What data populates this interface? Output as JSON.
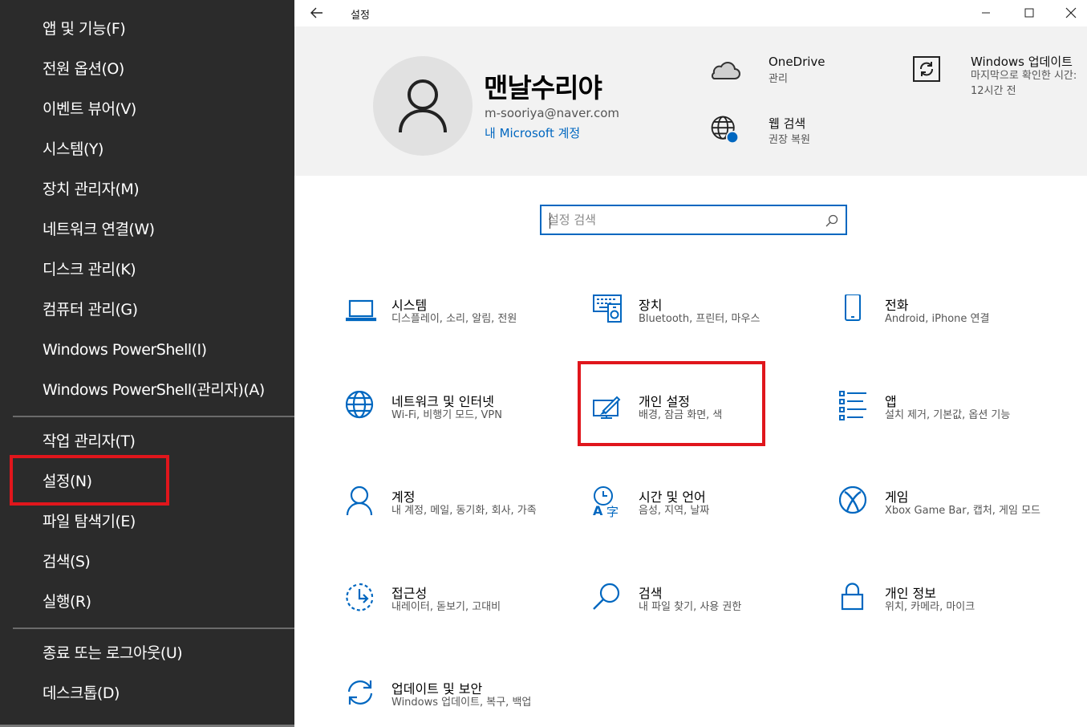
{
  "winx_menu": {
    "items": [
      {
        "label": "앱 및 기능(F)"
      },
      {
        "label": "전원 옵션(O)"
      },
      {
        "label": "이벤트 뷰어(V)"
      },
      {
        "label": "시스템(Y)"
      },
      {
        "label": "장치 관리자(M)"
      },
      {
        "label": "네트워크 연결(W)"
      },
      {
        "label": "디스크 관리(K)"
      },
      {
        "label": "컴퓨터 관리(G)"
      },
      {
        "label": "Windows PowerShell(I)"
      },
      {
        "label": "Windows PowerShell(관리자)(A)"
      },
      {
        "label": "작업 관리자(T)"
      },
      {
        "label": "설정(N)"
      },
      {
        "label": "파일 탐색기(E)"
      },
      {
        "label": "검색(S)"
      },
      {
        "label": "실행(R)"
      },
      {
        "label": "종료 또는 로그아웃(U)"
      },
      {
        "label": "데스크톱(D)"
      }
    ]
  },
  "window": {
    "title": "설정"
  },
  "account": {
    "name": "맨날수리야",
    "email": "m-sooriya@naver.com",
    "link": "내 Microsoft 계정"
  },
  "header_status": {
    "onedrive": {
      "title": "OneDrive",
      "sub": "관리"
    },
    "web_search": {
      "title": "웹 검색",
      "sub": "권장 복원"
    },
    "windows_update": {
      "title": "Windows 업데이트",
      "sub": "마지막으로 확인한 시간: 12시간 전"
    }
  },
  "search": {
    "placeholder": "설정 검색"
  },
  "categories": [
    {
      "title": "시스템",
      "sub": "디스플레이, 소리, 알림, 전원",
      "icon": "laptop-icon"
    },
    {
      "title": "장치",
      "sub": "Bluetooth, 프린터, 마우스",
      "icon": "devices-icon"
    },
    {
      "title": "전화",
      "sub": "Android, iPhone 연결",
      "icon": "phone-icon"
    },
    {
      "title": "네트워크 및 인터넷",
      "sub": "Wi-Fi, 비행기 모드, VPN",
      "icon": "globe-icon"
    },
    {
      "title": "개인 설정",
      "sub": "배경, 잠금 화면, 색",
      "icon": "personalization-icon"
    },
    {
      "title": "앱",
      "sub": "설치 제거, 기본값, 옵션 기능",
      "icon": "apps-list-icon"
    },
    {
      "title": "계정",
      "sub": "내 계정, 메일, 동기화, 회사, 가족",
      "icon": "person-icon"
    },
    {
      "title": "시간 및 언어",
      "sub": "음성, 지역, 날짜",
      "icon": "time-language-icon"
    },
    {
      "title": "게임",
      "sub": "Xbox Game Bar, 캡처, 게임 모드",
      "icon": "xbox-icon"
    },
    {
      "title": "접근성",
      "sub": "내레이터, 돋보기, 고대비",
      "icon": "ease-of-access-icon"
    },
    {
      "title": "검색",
      "sub": "내 파일 찾기, 사용 권한",
      "icon": "search-icon"
    },
    {
      "title": "개인 정보",
      "sub": "위치, 카메라, 마이크",
      "icon": "lock-icon"
    },
    {
      "title": "업데이트 및 보안",
      "sub": "Windows 업데이트, 복구, 백업",
      "icon": "update-sync-icon"
    }
  ],
  "colors": {
    "accent": "#0067c0",
    "menu_bg": "#2b2b2b",
    "header_bg": "#f2f2f2",
    "highlight_red": "#e0161c"
  }
}
